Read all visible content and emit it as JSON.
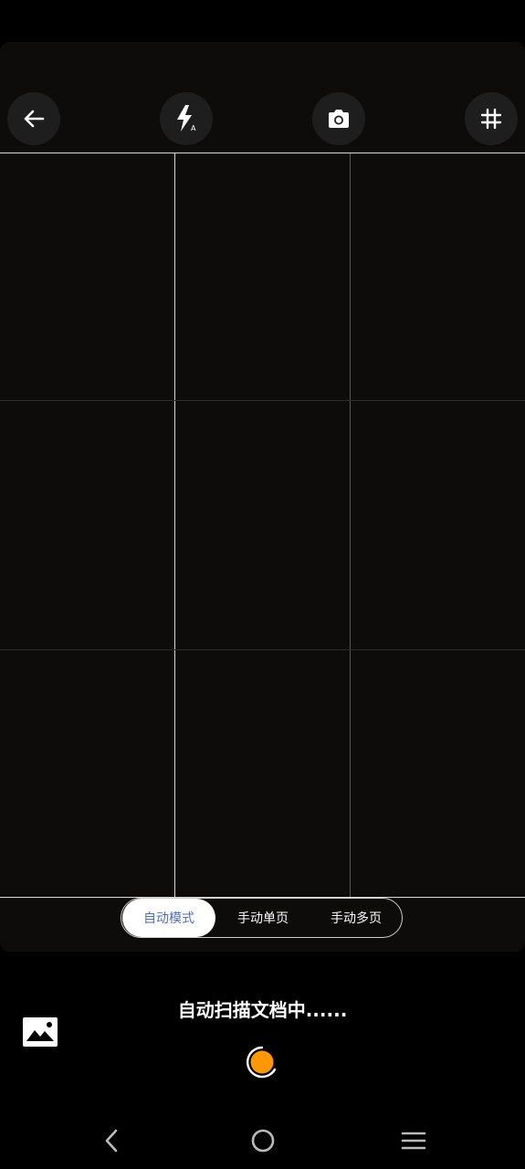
{
  "toolbar": {
    "back_icon": "arrow-left-icon",
    "flash_icon": "flash-auto-icon",
    "flash_badge": "A",
    "camera_icon": "camera-icon",
    "grid_icon": "hash-grid-icon"
  },
  "modes": {
    "items": [
      {
        "label": "自动模式",
        "active": true
      },
      {
        "label": "手动单页",
        "active": false
      },
      {
        "label": "手动多页",
        "active": false
      }
    ]
  },
  "status": {
    "text": "自动扫描文档中......"
  },
  "gallery": {
    "icon": "image-gallery-icon"
  },
  "shutter": {
    "icon": "capture-shutter-icon",
    "color": "#ff9800"
  },
  "system_nav": {
    "back_icon": "chevron-left-icon",
    "home_icon": "circle-home-icon",
    "menu_icon": "hamburger-menu-icon"
  },
  "colors": {
    "active_mode_text": "#4f6fb8",
    "viewfinder_bg": "#0e0b0b"
  }
}
